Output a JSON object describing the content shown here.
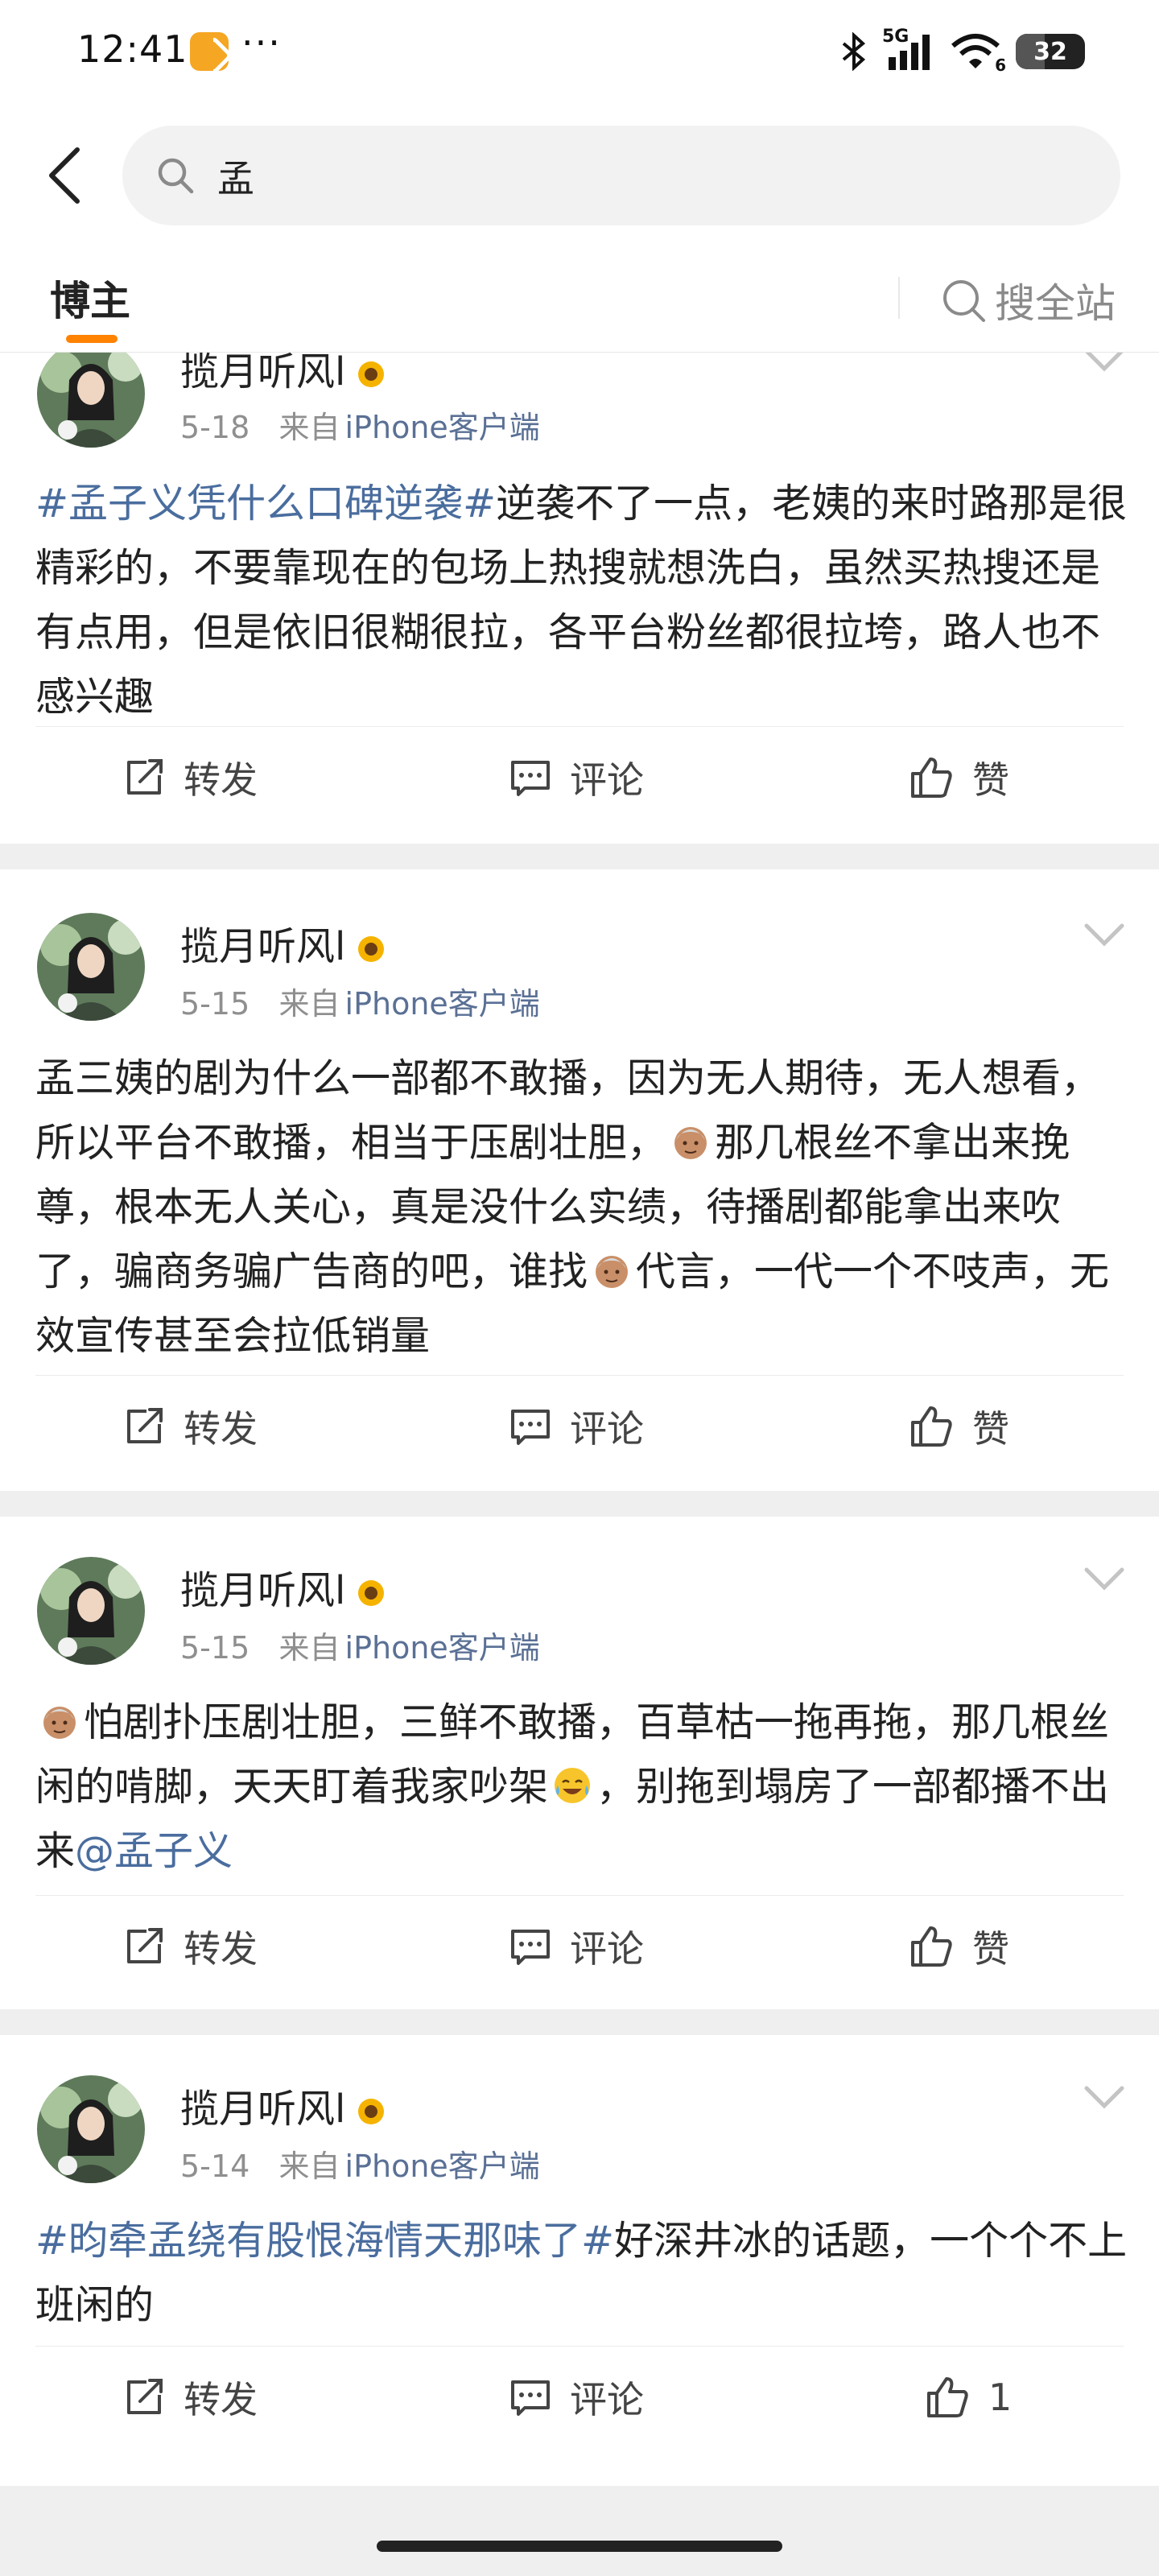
{
  "status_bar": {
    "time": "12:41",
    "dots": "···",
    "network": "5G",
    "wifi_label": "6",
    "battery": "32"
  },
  "search": {
    "query": "孟"
  },
  "tabs": {
    "active": "博主",
    "search_all": "搜全站"
  },
  "posts": [
    {
      "username": "揽月听风l",
      "date": "5-18",
      "source_prefix": "来自",
      "source": "iPhone客户端",
      "text_parts": [
        {
          "t": "#孟子义凭什么口碑逆袭#",
          "k": "topic"
        },
        {
          "t": "逆袭不了一点，老姨的来时路那是很精彩的，不要靠现在的包场上热搜就想洗白，虽然买热搜还是有点用，但是依旧很糊很拉，各平台粉丝都很拉垮，路人也不感兴趣",
          "k": "text"
        }
      ],
      "repost": "转发",
      "comment": "评论",
      "like": "赞"
    },
    {
      "username": "揽月听风l",
      "date": "5-15",
      "source_prefix": "来自",
      "source": "iPhone客户端",
      "text_parts": [
        {
          "t": "孟三姨的剧为什么一部都不敢播，因为无人期待，无人想看，所以平台不敢播，相当于压剧壮胆，",
          "k": "text"
        },
        {
          "t": "old-woman-emoji",
          "k": "emoji"
        },
        {
          "t": "那几根丝不拿出来挽尊，根本无人关心，真是没什么实绩，待播剧都能拿出来吹了，骗商务骗广告商的吧，谁找",
          "k": "text"
        },
        {
          "t": "old-woman-emoji",
          "k": "emoji"
        },
        {
          "t": "代言，一代一个不吱声，无效宣传甚至会拉低销量",
          "k": "text"
        }
      ],
      "repost": "转发",
      "comment": "评论",
      "like": "赞"
    },
    {
      "username": "揽月听风l",
      "date": "5-15",
      "source_prefix": "来自",
      "source": "iPhone客户端",
      "text_parts": [
        {
          "t": "old-woman-emoji",
          "k": "emoji"
        },
        {
          "t": "怕剧扑压剧壮胆，三鲜不敢播，百草枯一拖再拖，那几根丝闲的啃脚，天天盯着我家吵架",
          "k": "text"
        },
        {
          "t": "laugh-cry-emoji",
          "k": "emoji"
        },
        {
          "t": "，别拖到塌房了一部都播不出来",
          "k": "text"
        },
        {
          "t": "@孟子义",
          "k": "mention"
        }
      ],
      "repost": "转发",
      "comment": "评论",
      "like": "赞"
    },
    {
      "username": "揽月听风l",
      "date": "5-14",
      "source_prefix": "来自",
      "source": "iPhone客户端",
      "text_parts": [
        {
          "t": "#昀牵孟绕有股恨海情天那味了#",
          "k": "topic"
        },
        {
          "t": "好深井冰的话题，一个个不上班闲的",
          "k": "text"
        }
      ],
      "repost": "转发",
      "comment": "评论",
      "like": "1"
    }
  ],
  "colors": {
    "accent": "#ff8200",
    "link": "#4a6d9e",
    "meta": "#8f8f8f"
  }
}
